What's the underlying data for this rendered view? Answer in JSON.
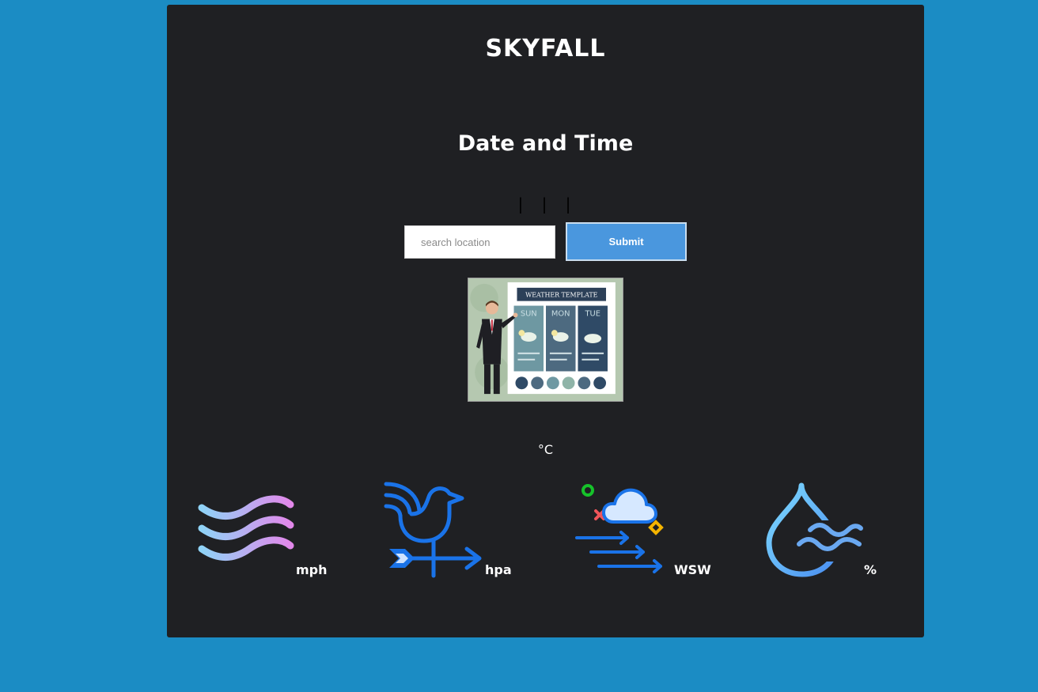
{
  "app": {
    "title": "SKYFALL",
    "date_heading": "Date and Time",
    "date_separators": "| | |"
  },
  "search": {
    "placeholder": "search location",
    "value": "",
    "submit_label": "Submit"
  },
  "image": {
    "alt": "weather template illustration",
    "banner_text": "WEATHER TEMPLATE",
    "days": [
      "SUN",
      "MON",
      "TUE"
    ]
  },
  "temperature": {
    "unit": "°C"
  },
  "stats": [
    {
      "name": "wind-speed",
      "icon": "wind-waves-icon",
      "unit": "mph"
    },
    {
      "name": "pressure",
      "icon": "weather-vane-icon",
      "unit": "hpa"
    },
    {
      "name": "wind-direction",
      "icon": "cloud-wind-icon",
      "unit": "WSW"
    },
    {
      "name": "humidity",
      "icon": "water-drop-icon",
      "unit": "%"
    }
  ],
  "colors": {
    "background": "#1b8cc4",
    "card": "#1f2023",
    "button": "#4a97de"
  }
}
